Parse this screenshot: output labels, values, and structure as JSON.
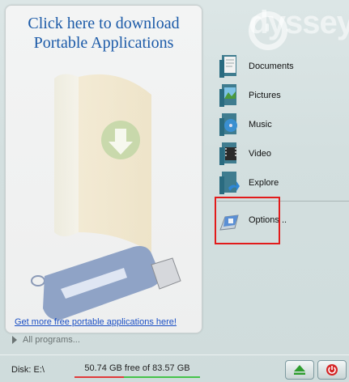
{
  "background": {
    "watermark_text": "dyssey"
  },
  "portable_panel": {
    "download_link_line1": "Click here to download",
    "download_link_line2": "Portable Applications",
    "more_apps_link": "Get more free portable applications here!"
  },
  "all_programs_label": "All programs...",
  "menu": {
    "items": [
      {
        "label": "Documents",
        "icon": "documents-folder-icon"
      },
      {
        "label": "Pictures",
        "icon": "pictures-folder-icon"
      },
      {
        "label": "Music",
        "icon": "music-folder-icon"
      },
      {
        "label": "Video",
        "icon": "video-folder-icon"
      },
      {
        "label": "Explore",
        "icon": "explore-folder-icon"
      },
      {
        "label": "Options ..",
        "icon": "options-icon"
      }
    ]
  },
  "status_bar": {
    "disk_label": "Disk: E:\\",
    "disk_free": "50.74 GB free of 83.57 GB",
    "disk_used_fraction": 0.393
  },
  "buttons": {
    "eject_icon": "eject-icon",
    "close_icon": "power-close-icon"
  },
  "colors": {
    "link_blue": "#1b5aa8",
    "highlight_red": "#e21b1b",
    "used_bar": "#e03b3b",
    "free_bar": "#45c34b"
  }
}
